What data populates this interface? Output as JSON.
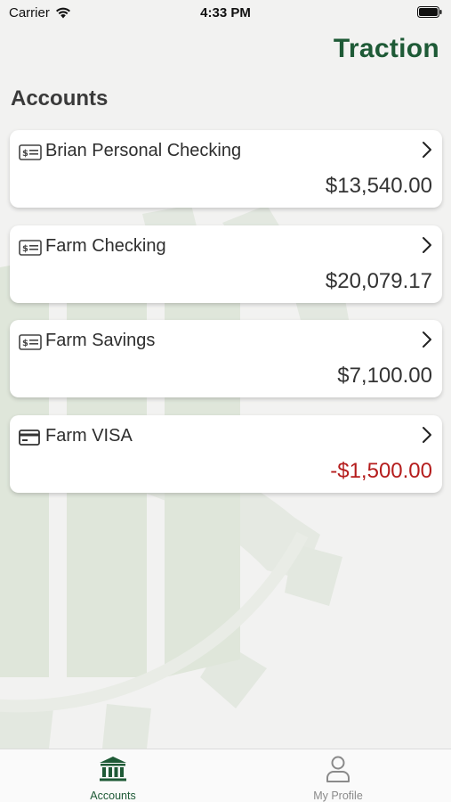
{
  "status_bar": {
    "carrier": "Carrier",
    "time": "4:33 PM"
  },
  "header": {
    "app_title": "Traction"
  },
  "section": {
    "title": "Accounts"
  },
  "accounts": [
    {
      "name": "Brian Personal Checking",
      "balance": "$13,540.00",
      "icon": "check-icon",
      "negative": false
    },
    {
      "name": "Farm Checking",
      "balance": "$20,079.17",
      "icon": "check-icon",
      "negative": false
    },
    {
      "name": "Farm Savings",
      "balance": "$7,100.00",
      "icon": "check-icon",
      "negative": false
    },
    {
      "name": "Farm VISA",
      "balance": "-$1,500.00",
      "icon": "credit-card-icon",
      "negative": true
    }
  ],
  "tabbar": {
    "accounts_label": "Accounts",
    "profile_label": "My Profile",
    "active_tab": "Accounts"
  },
  "colors": {
    "brand": "#1e5a36",
    "negative": "#b51d1d",
    "background": "#f2f2f1"
  }
}
